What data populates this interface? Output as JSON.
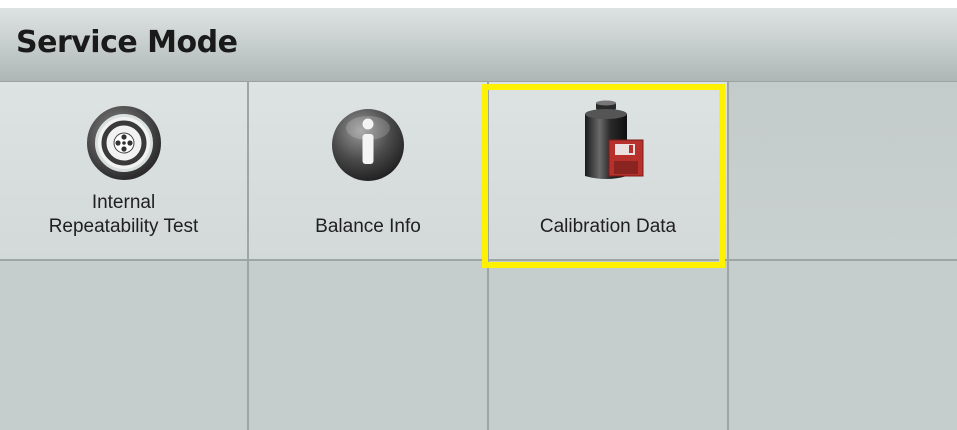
{
  "header": {
    "title": "Service Mode"
  },
  "menu": {
    "items": [
      {
        "label_line1": "Internal",
        "label_line2": "Repeatability Test",
        "icon": "target-icon"
      },
      {
        "label": "Balance Info",
        "icon": "info-icon"
      },
      {
        "label": "Calibration Data",
        "icon": "calibration-weight-save-icon",
        "selected": true
      }
    ]
  },
  "colors": {
    "selection_highlight": "#fff200",
    "save_badge": "#b8302b"
  }
}
